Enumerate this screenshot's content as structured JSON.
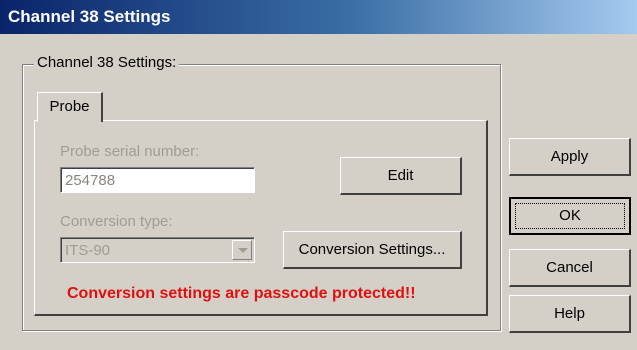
{
  "window": {
    "title": "Channel 38 Settings"
  },
  "group": {
    "label": "Channel 38 Settings:"
  },
  "tabs": [
    {
      "label": "Probe"
    }
  ],
  "probe": {
    "serial_label": "Probe serial number:",
    "serial_value": "254788",
    "edit_button": "Edit",
    "conversion_label": "Conversion type:",
    "conversion_value": "ITS-90",
    "conversion_settings_button": "Conversion Settings...",
    "warning": "Conversion settings are passcode protected!!"
  },
  "buttons": {
    "apply": "Apply",
    "ok": "OK",
    "cancel": "Cancel",
    "help": "Help"
  },
  "colors": {
    "title_start": "#0a246a",
    "title_end": "#a6caf0",
    "warning": "#e01010",
    "dialog_bg": "#d4d0c8"
  }
}
